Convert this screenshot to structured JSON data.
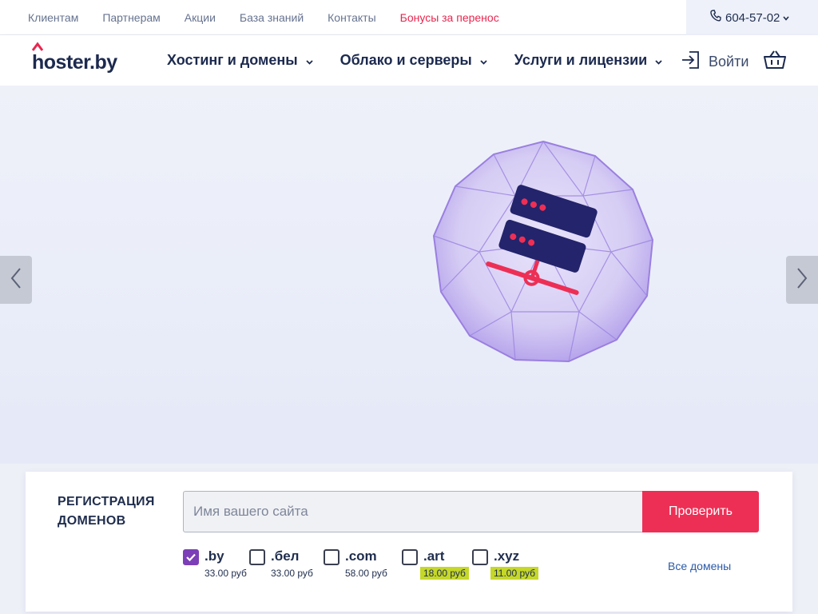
{
  "topbar": {
    "links": [
      "Клиентам",
      "Партнерам",
      "Акции",
      "База знаний",
      "Контакты"
    ],
    "promo_link": "Бонусы за перенос",
    "phone": "604-57-02"
  },
  "header": {
    "logo_text": "hoster.by",
    "nav": [
      "Хостинг и домены",
      "Облако и серверы",
      "Услуги и лицензии"
    ],
    "login_label": "Войти"
  },
  "domain_search": {
    "title": "Регистрация доменов",
    "placeholder": "Имя вашего сайта",
    "button_label": "Проверить",
    "zones": [
      {
        "name": ".by",
        "price": "33.00 руб",
        "checked": true,
        "promo": false
      },
      {
        "name": ".бел",
        "price": "33.00 руб",
        "checked": false,
        "promo": false
      },
      {
        "name": ".com",
        "price": "58.00 руб",
        "checked": false,
        "promo": false
      },
      {
        "name": ".art",
        "price": "18.00 руб",
        "checked": false,
        "promo": true
      },
      {
        "name": ".xyz",
        "price": "11.00 руб",
        "checked": false,
        "promo": true
      }
    ],
    "all_domains_label": "Все домены"
  },
  "colors": {
    "accent_red": "#ed2f55",
    "brand_navy": "#1c2a4f",
    "checkbox_purple": "#7c3fb8",
    "promo_price_bg": "#c5d729"
  },
  "icons": [
    "phone-icon",
    "chevron-down-icon",
    "login-icon",
    "cart-icon",
    "chevron-left-icon",
    "chevron-right-icon",
    "checkmark-icon"
  ]
}
